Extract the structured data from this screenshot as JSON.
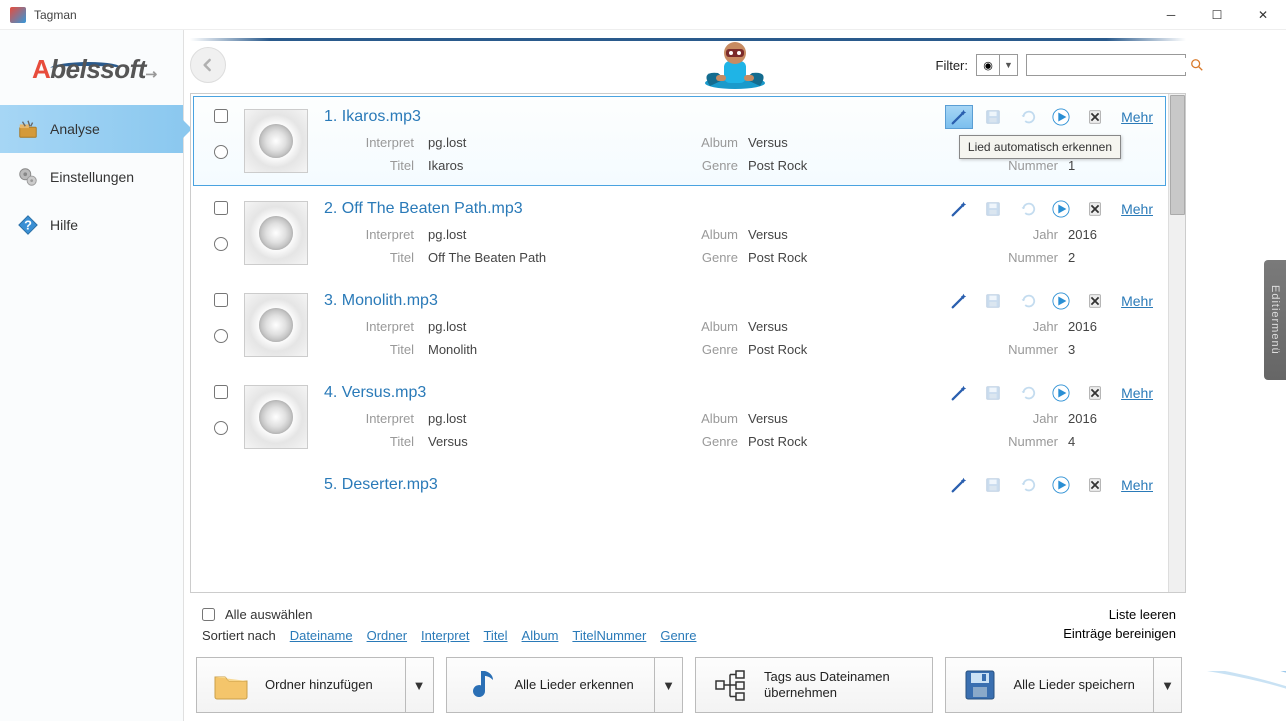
{
  "app": {
    "title": "Tagman",
    "brand_a": "A",
    "brand_rest": "belssoft"
  },
  "nav": {
    "items": [
      {
        "label": "Analyse",
        "icon": "🗂️",
        "active": true
      },
      {
        "label": "Einstellungen",
        "icon": "⚙️",
        "active": false
      },
      {
        "label": "Hilfe",
        "icon": "❓",
        "active": false
      }
    ]
  },
  "filter": {
    "label": "Filter:"
  },
  "labels": {
    "interpret": "Interpret",
    "titel": "Titel",
    "album": "Album",
    "genre": "Genre",
    "jahr": "Jahr",
    "nummer": "Nummer",
    "mehr": "Mehr"
  },
  "tooltip": {
    "auto_detect": "Lied automatisch erkennen"
  },
  "songs": [
    {
      "n": "1.",
      "file": "Ikaros.mp3",
      "interpret": "pg.lost",
      "titel": "Ikaros",
      "album": "Versus",
      "genre": "Post Rock",
      "jahr": "",
      "nummer": "1",
      "selected": true,
      "wand_hl": true
    },
    {
      "n": "2.",
      "file": "Off The Beaten Path.mp3",
      "interpret": "pg.lost",
      "titel": "Off The Beaten Path",
      "album": "Versus",
      "genre": "Post Rock",
      "jahr": "2016",
      "nummer": "2",
      "selected": false,
      "wand_hl": false
    },
    {
      "n": "3.",
      "file": "Monolith.mp3",
      "interpret": "pg.lost",
      "titel": "Monolith",
      "album": "Versus",
      "genre": "Post Rock",
      "jahr": "2016",
      "nummer": "3",
      "selected": false,
      "wand_hl": false
    },
    {
      "n": "4.",
      "file": "Versus.mp3",
      "interpret": "pg.lost",
      "titel": "Versus",
      "album": "Versus",
      "genre": "Post Rock",
      "jahr": "2016",
      "nummer": "4",
      "selected": false,
      "wand_hl": false
    },
    {
      "n": "5.",
      "file": "Deserter.mp3",
      "interpret": "",
      "titel": "",
      "album": "",
      "genre": "",
      "jahr": "",
      "nummer": "",
      "selected": false,
      "wand_hl": false
    }
  ],
  "bottom": {
    "select_all": "Alle auswählen",
    "sort_by": "Sortiert nach",
    "sort_keys": [
      "Dateiname",
      "Ordner",
      "Interpret",
      "Titel",
      "Album",
      "TitelNummer",
      "Genre"
    ],
    "list_clear": "Liste leeren",
    "entries_clean": "Einträge bereinigen"
  },
  "buttons": {
    "add_folder": "Ordner hinzufügen",
    "detect_all": "Alle Lieder erkennen",
    "from_filenames_l1": "Tags aus Dateinamen",
    "from_filenames_l2": "übernehmen",
    "save_all": "Alle Lieder speichern"
  },
  "sidetab": {
    "label": "Editiermenü"
  }
}
